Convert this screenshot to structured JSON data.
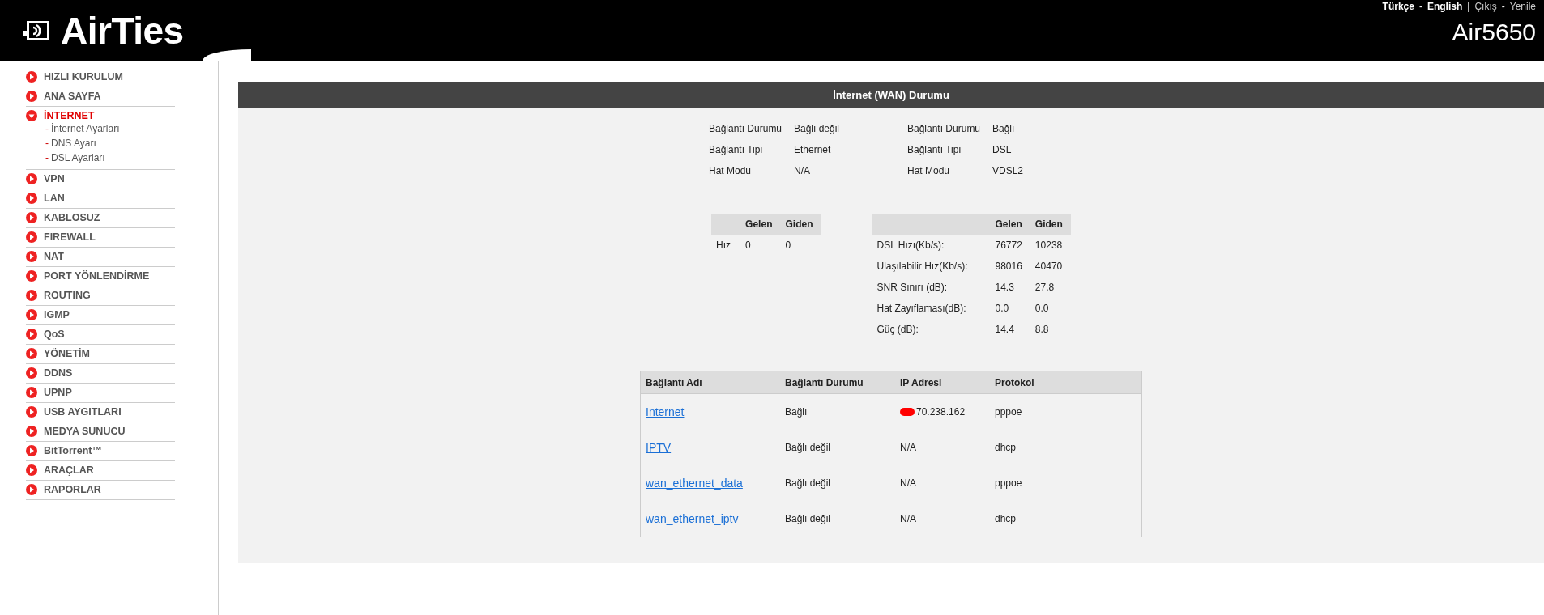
{
  "header": {
    "logo": "AirTies",
    "top_links": [
      {
        "kind": "language",
        "text": "Türkçe"
      },
      {
        "kind": "separator",
        "text": "-"
      },
      {
        "kind": "language",
        "text": "English"
      },
      {
        "kind": "separator",
        "text": "|"
      },
      {
        "kind": "action",
        "text": "Çıkış"
      },
      {
        "kind": "separator",
        "text": "-"
      },
      {
        "kind": "action",
        "text": "Yenile"
      }
    ],
    "model": "Air5650"
  },
  "sidebar": {
    "submenu_marker": "-",
    "items": [
      {
        "label": "HIZLI KURULUM",
        "selected": false,
        "expanded": false
      },
      {
        "label": "ANA SAYFA",
        "selected": false,
        "expanded": false
      },
      {
        "label": "İNTERNET",
        "selected": true,
        "expanded": true,
        "children": [
          "İnternet Ayarları",
          "DNS Ayarı",
          "DSL Ayarları"
        ]
      },
      {
        "label": "VPN",
        "selected": false,
        "expanded": false
      },
      {
        "label": "LAN",
        "selected": false,
        "expanded": false
      },
      {
        "label": "KABLOSUZ",
        "selected": false,
        "expanded": false
      },
      {
        "label": "FIREWALL",
        "selected": false,
        "expanded": false
      },
      {
        "label": "NAT",
        "selected": false,
        "expanded": false
      },
      {
        "label": "PORT YÖNLENDİRME",
        "selected": false,
        "expanded": false
      },
      {
        "label": "ROUTING",
        "selected": false,
        "expanded": false
      },
      {
        "label": "IGMP",
        "selected": false,
        "expanded": false
      },
      {
        "label": "QoS",
        "selected": false,
        "expanded": false
      },
      {
        "label": "YÖNETİM",
        "selected": false,
        "expanded": false
      },
      {
        "label": "DDNS",
        "selected": false,
        "expanded": false
      },
      {
        "label": "UPNP",
        "selected": false,
        "expanded": false
      },
      {
        "label": "USB AYGITLARI",
        "selected": false,
        "expanded": false
      },
      {
        "label": "MEDYA SUNUCU",
        "selected": false,
        "expanded": false
      },
      {
        "label": "BitTorrent™",
        "selected": false,
        "expanded": false
      },
      {
        "label": "ARAÇLAR",
        "selected": false,
        "expanded": false
      },
      {
        "label": "RAPORLAR",
        "selected": false,
        "expanded": false
      }
    ]
  },
  "panel": {
    "title": "İnternet (WAN) Durumu",
    "info_groups": [
      [
        {
          "label": "Bağlantı Durumu",
          "value": "Bağlı değil"
        },
        {
          "label": "Bağlantı Tipi",
          "value": "Ethernet"
        },
        {
          "label": "Hat Modu",
          "value": "N/A"
        }
      ],
      [
        {
          "label": "Bağlantı Durumu",
          "value": "Bağlı"
        },
        {
          "label": "Bağlantı Tipi",
          "value": "DSL"
        },
        {
          "label": "Hat Modu",
          "value": "VDSL2"
        }
      ]
    ],
    "speed_tables": [
      {
        "columns": [
          "",
          "Gelen",
          "Giden"
        ],
        "rows": [
          [
            "Hız",
            "0",
            "0"
          ]
        ]
      },
      {
        "columns": [
          "",
          "Gelen",
          "Giden"
        ],
        "rows": [
          [
            "DSL Hızı(Kb/s):",
            "76772",
            "10238"
          ],
          [
            "Ulaşılabilir Hız(Kb/s):",
            "98016",
            "40470"
          ],
          [
            "SNR Sınırı (dB):",
            "14.3",
            "27.8"
          ],
          [
            "Hat Zayıflaması(dB):",
            "0.0",
            "0.0"
          ],
          [
            "Güç (dB):",
            "14.4",
            "8.8"
          ]
        ]
      }
    ],
    "connections": {
      "columns": [
        "Bağlantı Adı",
        "Bağlantı Durumu",
        "IP Adresi",
        "Protokol"
      ],
      "rows": [
        {
          "name": "Internet",
          "status": "Bağlı",
          "ip": "70.238.162",
          "redacted": true,
          "protocol": "pppoe"
        },
        {
          "name": "IPTV",
          "status": "Bağlı değil",
          "ip": "N/A",
          "redacted": false,
          "protocol": "dhcp"
        },
        {
          "name": "wan_ethernet_data",
          "status": "Bağlı değil",
          "ip": "N/A",
          "redacted": false,
          "protocol": "pppoe"
        },
        {
          "name": "wan_ethernet_iptv",
          "status": "Bağlı değil",
          "ip": "N/A",
          "redacted": false,
          "protocol": "dhcp"
        }
      ]
    }
  }
}
